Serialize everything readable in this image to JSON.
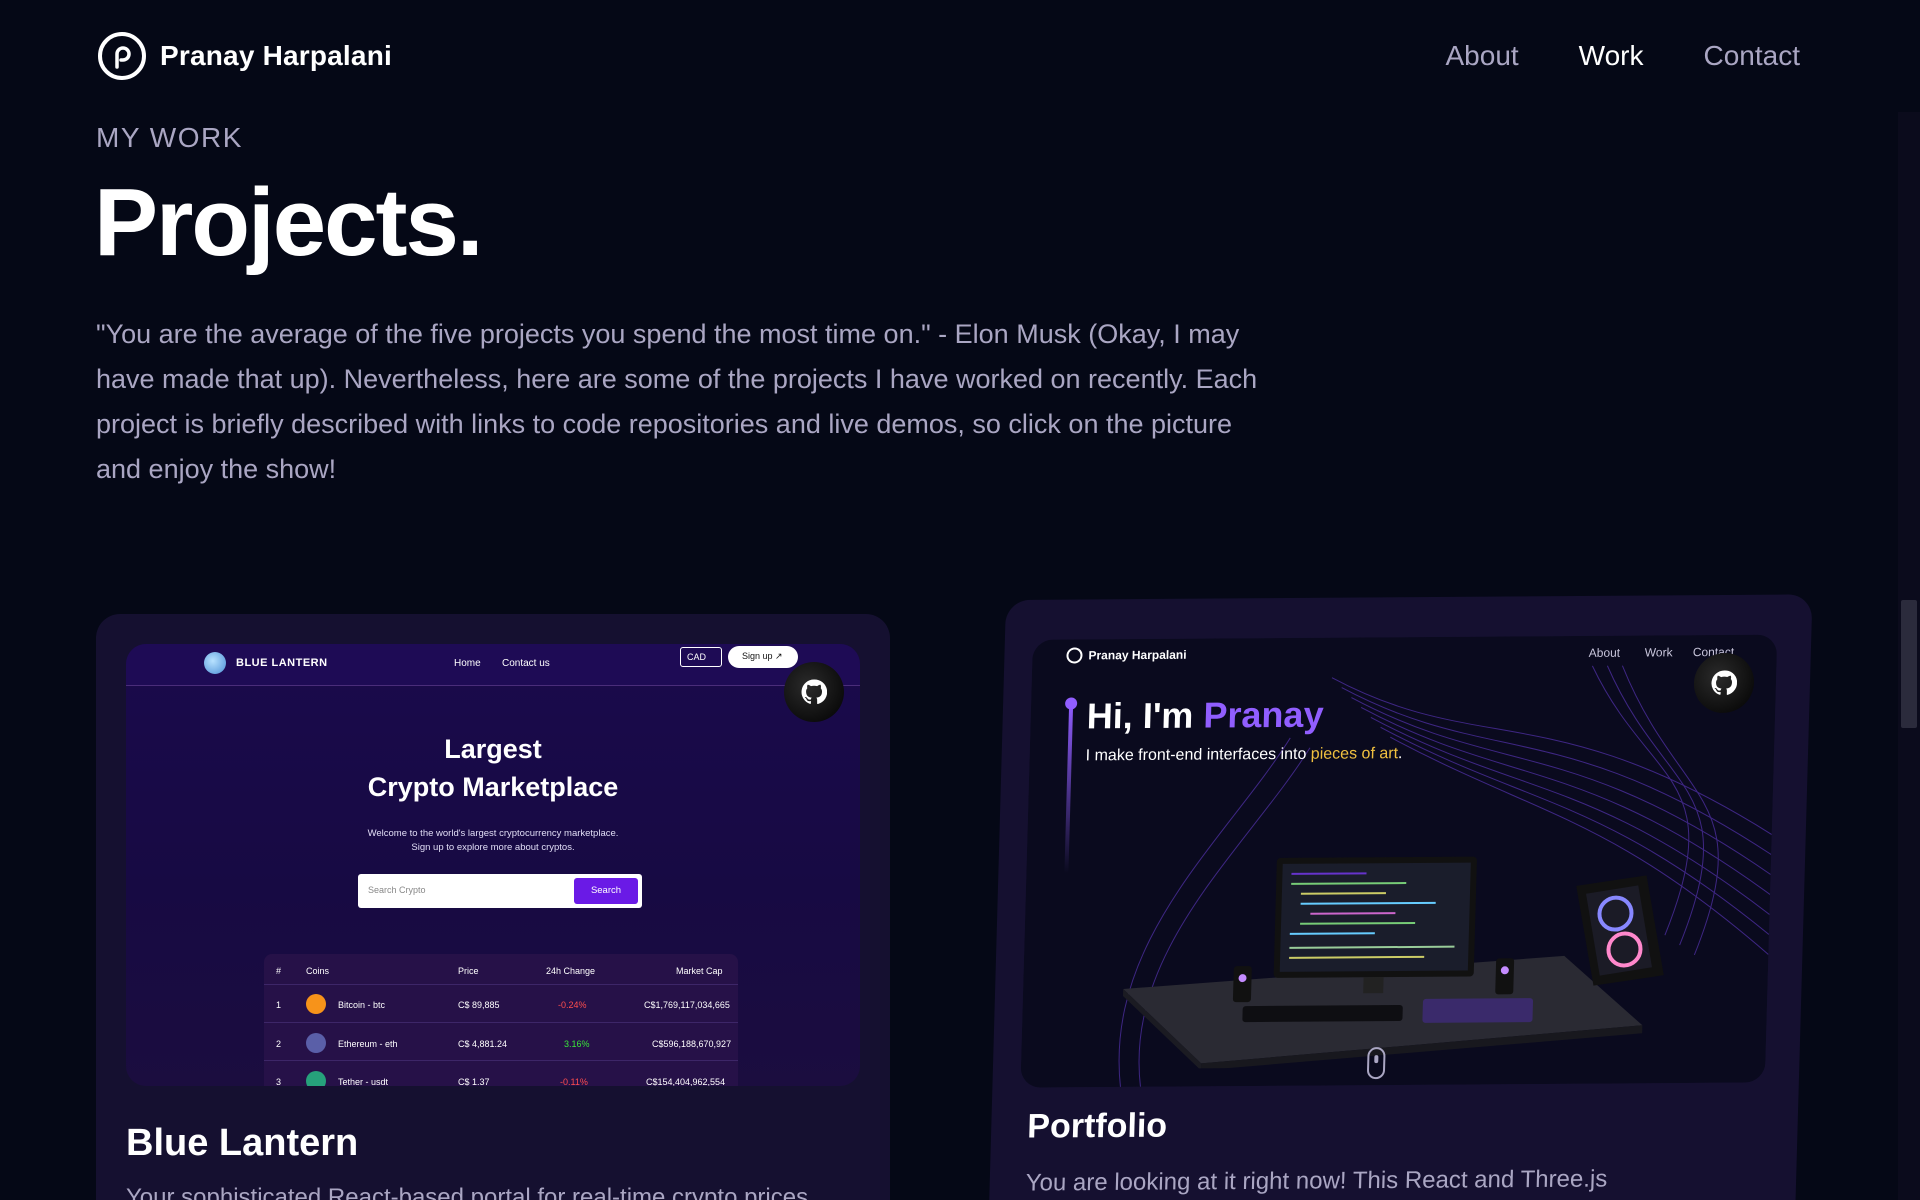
{
  "navbar": {
    "brand": "Pranay Harpalani",
    "links": [
      "About",
      "Work",
      "Contact"
    ],
    "active": "Work"
  },
  "section": {
    "subtitle": "MY WORK",
    "title": "Projects.",
    "description": "\"You are the average of the five projects you spend the most time on.\" - Elon Musk (Okay, I may have made that up). Nevertheless, here are some of the projects I have worked on recently. Each project is briefly described with links to code repositories and live demos, so click on the picture and enjoy the show!"
  },
  "colors": {
    "background": "#050816",
    "card": "#151030",
    "secondary_text": "#aaa6c3",
    "accent": "#915eff"
  },
  "projects": [
    {
      "title": "Blue Lantern",
      "description": "Your sophisticated React-based portal for real-time crypto prices",
      "github_icon": "github-icon",
      "screenshot": {
        "brand": "BLUE LANTERN",
        "nav": [
          "Home",
          "Contact us"
        ],
        "currency": "CAD",
        "signup": "Sign up ↗",
        "heading_line1": "Largest",
        "heading_line2": "Crypto Marketplace",
        "sub_line1": "Welcome to the world's largest cryptocurrency marketplace.",
        "sub_line2": "Sign up to explore more about cryptos.",
        "search_placeholder": "Search Crypto",
        "search_button": "Search",
        "table_headers": [
          "#",
          "Coins",
          "Price",
          "24h Change",
          "Market Cap"
        ],
        "rows": [
          {
            "rank": "1",
            "coin": "Bitcoin - btc",
            "price": "C$ 89,885",
            "change": "-0.24%",
            "cap": "C$1,769,117,034,665",
            "positive": false
          },
          {
            "rank": "2",
            "coin": "Ethereum - eth",
            "price": "C$ 4,881.24",
            "change": "3.16%",
            "cap": "C$596,188,670,927",
            "positive": true
          },
          {
            "rank": "3",
            "coin": "Tether - usdt",
            "price": "C$ 1.37",
            "change": "-0.11%",
            "cap": "C$154,404,962,554",
            "positive": false
          }
        ]
      }
    },
    {
      "title": "Portfolio",
      "description": "You are looking at it right now! This React and Three.js p...",
      "description_visible": "You are looking at it right now! This React and Three.js",
      "github_icon": "github-icon",
      "screenshot": {
        "brand": "Pranay Harpalani",
        "nav": [
          "About",
          "Work",
          "Contact"
        ],
        "hi": "Hi, I'm ",
        "name": "Pranay",
        "tagline_start": "I make front-end interfaces into ",
        "tagline_accent": "pieces of art",
        "tagline_end": "."
      }
    }
  ]
}
